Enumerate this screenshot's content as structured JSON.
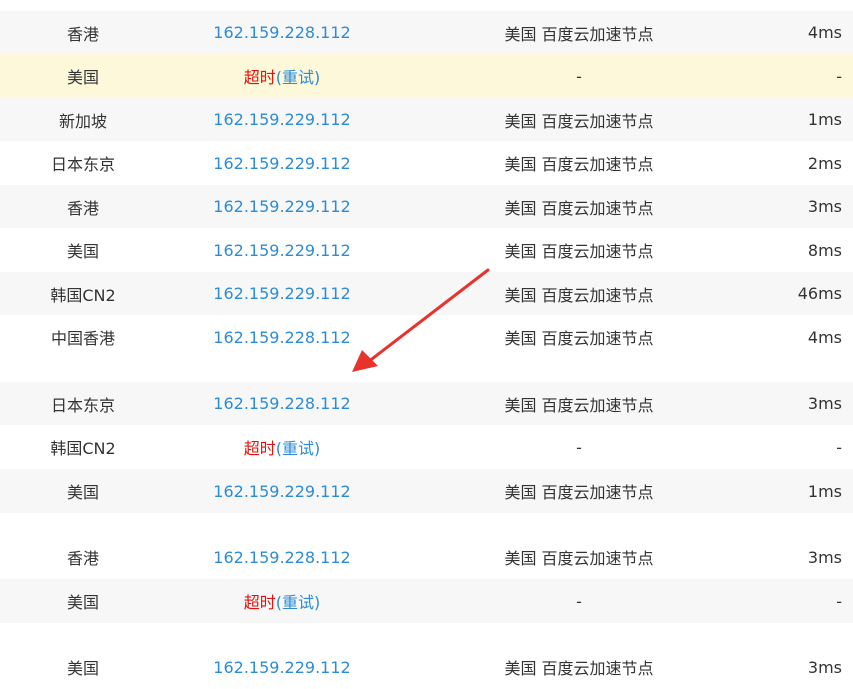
{
  "rows": [
    {
      "location": "香港",
      "ip": "162.159.228.112",
      "isp": "美国 百度云加速节点",
      "time": "4ms"
    },
    {
      "location": "美国",
      "timeout_label": "超时",
      "retry_label": "重试",
      "isp": "-",
      "time": "-"
    },
    {
      "location": "新加坡",
      "ip": "162.159.229.112",
      "isp": "美国 百度云加速节点",
      "time": "1ms"
    },
    {
      "location": "日本东京",
      "ip": "162.159.229.112",
      "isp": "美国 百度云加速节点",
      "time": "2ms"
    },
    {
      "location": "香港",
      "ip": "162.159.229.112",
      "isp": "美国 百度云加速节点",
      "time": "3ms"
    },
    {
      "location": "美国",
      "ip": "162.159.229.112",
      "isp": "美国 百度云加速节点",
      "time": "8ms"
    },
    {
      "location": "韩国CN2",
      "ip": "162.159.229.112",
      "isp": "美国 百度云加速节点",
      "time": "46ms"
    },
    {
      "location": "中国香港",
      "ip": "162.159.228.112",
      "isp": "美国 百度云加速节点",
      "time": "4ms"
    },
    {
      "location": "日本东京",
      "ip": "162.159.228.112",
      "isp": "美国 百度云加速节点",
      "time": "3ms"
    },
    {
      "location": "韩国CN2",
      "timeout_label": "超时",
      "retry_label": "重试",
      "isp": "-",
      "time": "-"
    },
    {
      "location": "美国",
      "ip": "162.159.229.112",
      "isp": "美国 百度云加速节点",
      "time": "1ms"
    },
    {
      "location": "香港",
      "ip": "162.159.228.112",
      "isp": "美国 百度云加速节点",
      "time": "3ms"
    },
    {
      "location": "美国",
      "timeout_label": "超时",
      "retry_label": "重试",
      "isp": "-",
      "time": "-"
    },
    {
      "location": "美国",
      "ip": "162.159.229.112",
      "isp": "美国 百度云加速节点",
      "time": "3ms"
    }
  ],
  "colors": {
    "link": "#2d8cd6",
    "timeout": "#e8110c",
    "highlight_row": "#fcf8d9",
    "alt_row": "#f7f7f7",
    "annotation_arrow": "#e8322c"
  }
}
